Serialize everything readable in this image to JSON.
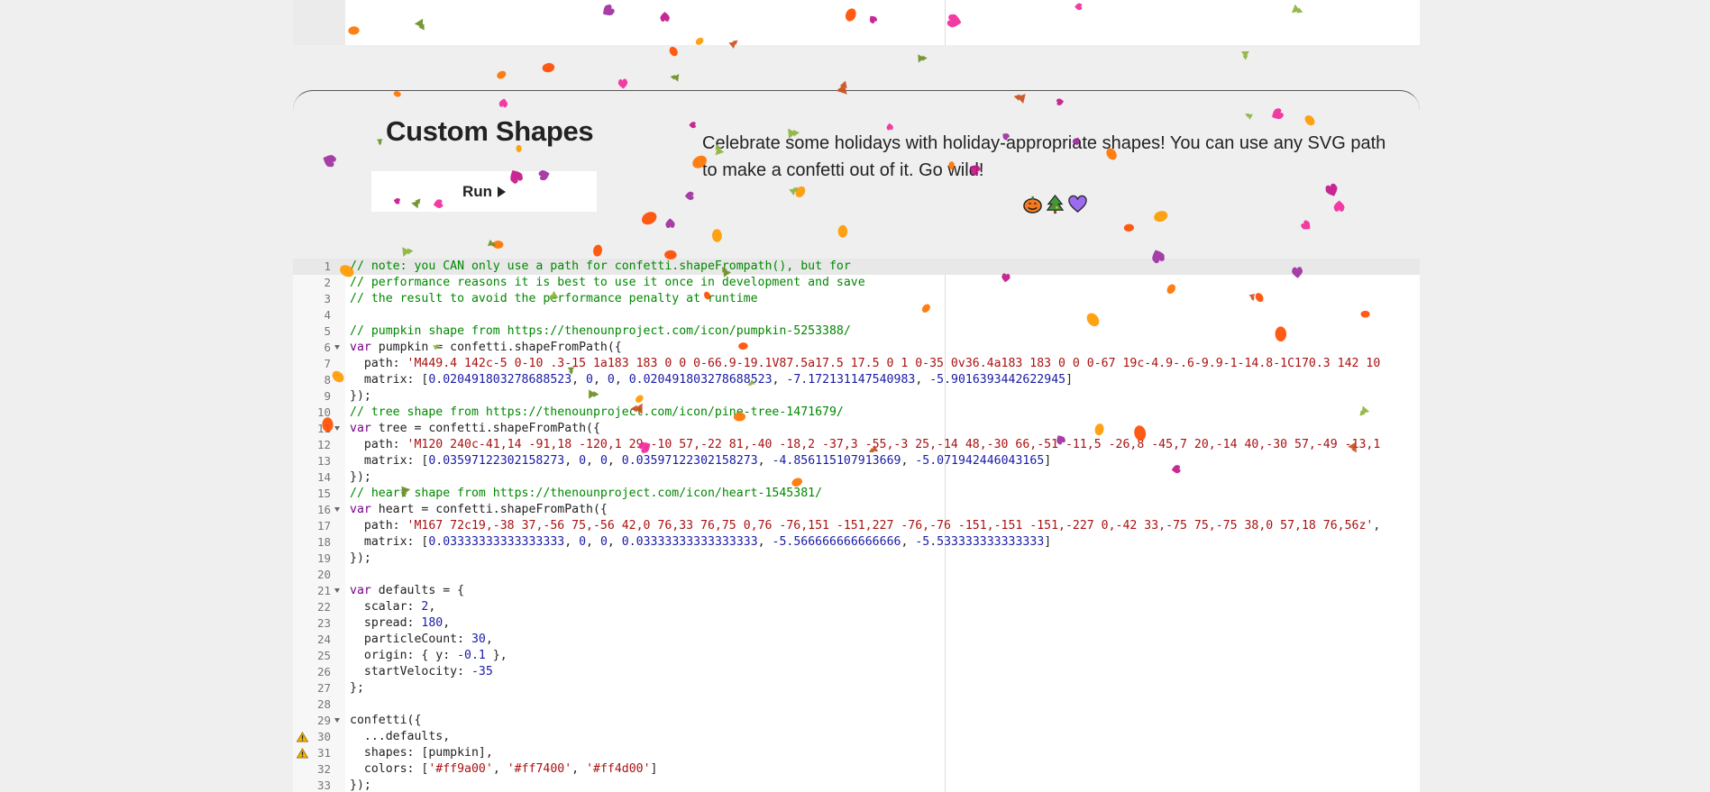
{
  "section": {
    "title": "Custom Shapes",
    "run_label": "Run",
    "description": "Celebrate some holidays with holiday-appropriate shapes! You can use any SVG path to make a confetti out of it. Go wild!"
  },
  "editor": {
    "lines": [
      {
        "n": "1",
        "fold": false,
        "warn": false,
        "segments": [
          [
            "c-comment",
            "// note: you CAN only use a path for confetti.shapeFrompath(), but for"
          ]
        ]
      },
      {
        "n": "2",
        "fold": false,
        "warn": false,
        "segments": [
          [
            "c-comment",
            "// performance reasons it is best to use it once in development and save"
          ]
        ]
      },
      {
        "n": "3",
        "fold": false,
        "warn": false,
        "segments": [
          [
            "c-comment",
            "// the result to avoid the performance penalty at runtime"
          ]
        ]
      },
      {
        "n": "4",
        "fold": false,
        "warn": false,
        "segments": []
      },
      {
        "n": "5",
        "fold": false,
        "warn": false,
        "segments": [
          [
            "c-comment",
            "// pumpkin shape from https://thenounproject.com/icon/pumpkin-5253388/"
          ]
        ]
      },
      {
        "n": "6",
        "fold": true,
        "warn": false,
        "segments": [
          [
            "c-kw",
            "var"
          ],
          [
            "c-def",
            " pumpkin = confetti.shapeFromPath({"
          ]
        ]
      },
      {
        "n": "7",
        "fold": false,
        "warn": false,
        "segments": [
          [
            "c-def",
            "  path: "
          ],
          [
            "c-str",
            "'M449.4 142c-5 0-10 .3-15 1a183 183 0 0 0-66.9-19.1V87.5a17.5 17.5 0 1 0-35 0v36.4a183 183 0 0 0-67 19c-4.9-.6-9.9-1-14.8-1C170.3 142 10"
          ]
        ]
      },
      {
        "n": "8",
        "fold": false,
        "warn": false,
        "segments": [
          [
            "c-def",
            "  matrix: ["
          ],
          [
            "c-num2",
            "0.020491803278688523"
          ],
          [
            "c-def",
            ", "
          ],
          [
            "c-num2",
            "0"
          ],
          [
            "c-def",
            ", "
          ],
          [
            "c-num2",
            "0"
          ],
          [
            "c-def",
            ", "
          ],
          [
            "c-num2",
            "0.020491803278688523"
          ],
          [
            "c-def",
            ", "
          ],
          [
            "c-num2",
            "-7.172131147540983"
          ],
          [
            "c-def",
            ", "
          ],
          [
            "c-num2",
            "-5.9016393442622945"
          ],
          [
            "c-def",
            "]"
          ]
        ]
      },
      {
        "n": "9",
        "fold": false,
        "warn": false,
        "segments": [
          [
            "c-def",
            "});"
          ]
        ]
      },
      {
        "n": "10",
        "fold": false,
        "warn": false,
        "segments": [
          [
            "c-comment",
            "// tree shape from https://thenounproject.com/icon/pine-tree-1471679/"
          ]
        ]
      },
      {
        "n": "11",
        "fold": true,
        "warn": false,
        "segments": [
          [
            "c-kw",
            "var"
          ],
          [
            "c-def",
            " tree = confetti.shapeFromPath({"
          ]
        ]
      },
      {
        "n": "12",
        "fold": false,
        "warn": false,
        "segments": [
          [
            "c-def",
            "  path: "
          ],
          [
            "c-str",
            "'M120 240c-41,14 -91,18 -120,1 29,-10 57,-22 81,-40 -18,2 -37,3 -55,-3 25,-14 48,-30 66,-51 -11,5 -26,8 -45,7 20,-14 40,-30 57,-49 -13,1"
          ]
        ]
      },
      {
        "n": "13",
        "fold": false,
        "warn": false,
        "segments": [
          [
            "c-def",
            "  matrix: ["
          ],
          [
            "c-num2",
            "0.03597122302158273"
          ],
          [
            "c-def",
            ", "
          ],
          [
            "c-num2",
            "0"
          ],
          [
            "c-def",
            ", "
          ],
          [
            "c-num2",
            "0"
          ],
          [
            "c-def",
            ", "
          ],
          [
            "c-num2",
            "0.03597122302158273"
          ],
          [
            "c-def",
            ", "
          ],
          [
            "c-num2",
            "-4.856115107913669"
          ],
          [
            "c-def",
            ", "
          ],
          [
            "c-num2",
            "-5.071942446043165"
          ],
          [
            "c-def",
            "]"
          ]
        ]
      },
      {
        "n": "14",
        "fold": false,
        "warn": false,
        "segments": [
          [
            "c-def",
            "});"
          ]
        ]
      },
      {
        "n": "15",
        "fold": false,
        "warn": false,
        "segments": [
          [
            "c-comment",
            "// heart shape from https://thenounproject.com/icon/heart-1545381/"
          ]
        ]
      },
      {
        "n": "16",
        "fold": true,
        "warn": false,
        "segments": [
          [
            "c-kw",
            "var"
          ],
          [
            "c-def",
            " heart = confetti.shapeFromPath({"
          ]
        ]
      },
      {
        "n": "17",
        "fold": false,
        "warn": false,
        "segments": [
          [
            "c-def",
            "  path: "
          ],
          [
            "c-str",
            "'M167 72c19,-38 37,-56 75,-56 42,0 76,33 76,75 0,76 -76,151 -151,227 -76,-76 -151,-151 -151,-227 0,-42 33,-75 75,-75 38,0 57,18 76,56z'"
          ],
          [
            "c-def",
            ","
          ]
        ]
      },
      {
        "n": "18",
        "fold": false,
        "warn": false,
        "segments": [
          [
            "c-def",
            "  matrix: ["
          ],
          [
            "c-num2",
            "0.03333333333333333"
          ],
          [
            "c-def",
            ", "
          ],
          [
            "c-num2",
            "0"
          ],
          [
            "c-def",
            ", "
          ],
          [
            "c-num2",
            "0"
          ],
          [
            "c-def",
            ", "
          ],
          [
            "c-num2",
            "0.03333333333333333"
          ],
          [
            "c-def",
            ", "
          ],
          [
            "c-num2",
            "-5.566666666666666"
          ],
          [
            "c-def",
            ", "
          ],
          [
            "c-num2",
            "-5.533333333333333"
          ],
          [
            "c-def",
            "]"
          ]
        ]
      },
      {
        "n": "19",
        "fold": false,
        "warn": false,
        "segments": [
          [
            "c-def",
            "});"
          ]
        ]
      },
      {
        "n": "20",
        "fold": false,
        "warn": false,
        "segments": []
      },
      {
        "n": "21",
        "fold": true,
        "warn": false,
        "segments": [
          [
            "c-kw",
            "var"
          ],
          [
            "c-def",
            " defaults = {"
          ]
        ]
      },
      {
        "n": "22",
        "fold": false,
        "warn": false,
        "segments": [
          [
            "c-def",
            "  scalar: "
          ],
          [
            "c-num2",
            "2"
          ],
          [
            "c-def",
            ","
          ]
        ]
      },
      {
        "n": "23",
        "fold": false,
        "warn": false,
        "segments": [
          [
            "c-def",
            "  spread: "
          ],
          [
            "c-num2",
            "180"
          ],
          [
            "c-def",
            ","
          ]
        ]
      },
      {
        "n": "24",
        "fold": false,
        "warn": false,
        "segments": [
          [
            "c-def",
            "  particleCount: "
          ],
          [
            "c-num2",
            "30"
          ],
          [
            "c-def",
            ","
          ]
        ]
      },
      {
        "n": "25",
        "fold": false,
        "warn": false,
        "segments": [
          [
            "c-def",
            "  origin: { y: "
          ],
          [
            "c-num2",
            "-0.1"
          ],
          [
            "c-def",
            " },"
          ]
        ]
      },
      {
        "n": "26",
        "fold": false,
        "warn": false,
        "segments": [
          [
            "c-def",
            "  startVelocity: "
          ],
          [
            "c-num2",
            "-35"
          ]
        ]
      },
      {
        "n": "27",
        "fold": false,
        "warn": false,
        "segments": [
          [
            "c-def",
            "};"
          ]
        ]
      },
      {
        "n": "28",
        "fold": false,
        "warn": false,
        "segments": []
      },
      {
        "n": "29",
        "fold": true,
        "warn": false,
        "segments": [
          [
            "c-def",
            "confetti({"
          ]
        ]
      },
      {
        "n": "30",
        "fold": false,
        "warn": true,
        "segments": [
          [
            "c-def",
            "  ...defaults,"
          ]
        ]
      },
      {
        "n": "31",
        "fold": false,
        "warn": true,
        "segments": [
          [
            "c-def",
            "  shapes: [pumpkin],"
          ]
        ]
      },
      {
        "n": "32",
        "fold": false,
        "warn": false,
        "segments": [
          [
            "c-def",
            "  colors: ["
          ],
          [
            "c-str",
            "'#ff9a00'"
          ],
          [
            "c-def",
            ", "
          ],
          [
            "c-str",
            "'#ff7400'"
          ],
          [
            "c-def",
            ", "
          ],
          [
            "c-str",
            "'#ff4d00'"
          ],
          [
            "c-def",
            "]"
          ]
        ]
      },
      {
        "n": "33",
        "fold": false,
        "warn": false,
        "segments": [
          [
            "c-def",
            "});"
          ]
        ]
      }
    ]
  },
  "colors": {
    "pumpkin": [
      "#ff9a00",
      "#ff7400",
      "#ff4d00"
    ],
    "tree": [
      "#8cb43c",
      "#6b8e23",
      "#c8501e"
    ],
    "heart": [
      "#f22a9c",
      "#c4168a",
      "#9e2fa0"
    ]
  }
}
